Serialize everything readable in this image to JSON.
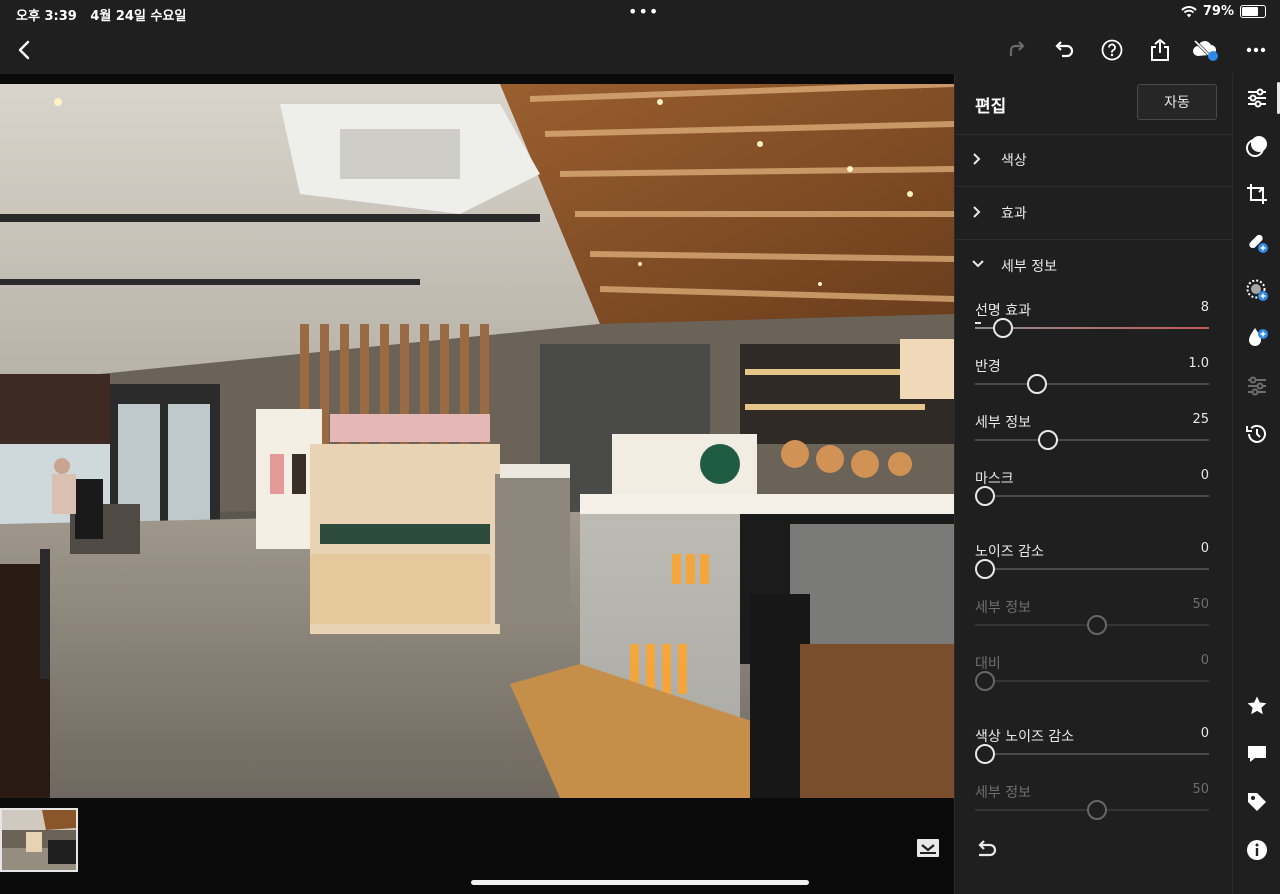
{
  "status_bar": {
    "time": "오후 3:39",
    "date": "4월 24일 수요일",
    "dots": "•••",
    "battery": "79%",
    "battery_level": 0.79
  },
  "top_bar": {
    "icons": [
      "back-icon",
      "redo-icon",
      "undo-icon",
      "help-icon",
      "share-icon",
      "cloud-sync-icon",
      "more-icon"
    ]
  },
  "panel": {
    "title": "편집",
    "auto_label": "자동",
    "sections": [
      {
        "label": "색상",
        "expanded": false
      },
      {
        "label": "효과",
        "expanded": false
      },
      {
        "label": "세부 정보",
        "expanded": true
      }
    ],
    "sliders": [
      {
        "label": "선명 효과",
        "value": "8",
        "level": 0.08,
        "enabled": true
      },
      {
        "label": "반경",
        "value": "1.0",
        "level": 0.23,
        "enabled": true
      },
      {
        "label": "세부 정보",
        "value": "25",
        "level": 0.28,
        "enabled": true
      },
      {
        "label": "마스크",
        "value": "0",
        "level": 0.0,
        "enabled": true
      },
      {
        "label": "노이즈 감소",
        "value": "0",
        "level": 0.0,
        "enabled": true
      },
      {
        "label": "세부 정보",
        "value": "50",
        "level": 0.5,
        "enabled": false
      },
      {
        "label": "대비",
        "value": "0",
        "level": 0.0,
        "enabled": false
      },
      {
        "label": "색상 노이즈 감소",
        "value": "0",
        "level": 0.0,
        "enabled": true
      },
      {
        "label": "세부 정보",
        "value": "50",
        "level": 0.5,
        "enabled": false
      }
    ]
  },
  "right_rail": {
    "tools": [
      "edit-sliders-icon",
      "presets-icon",
      "crop-icon",
      "healing-icon",
      "masking-icon",
      "optics-icon",
      "geometry-icon",
      "versions-icon"
    ],
    "bottom": [
      "star-icon",
      "comment-icon",
      "tag-icon",
      "info-icon"
    ]
  },
  "colors": {
    "background": "#1f1f1f",
    "accent_blue": "#2e8ae6",
    "sharpen_gradient_end": "#c55a5a"
  }
}
